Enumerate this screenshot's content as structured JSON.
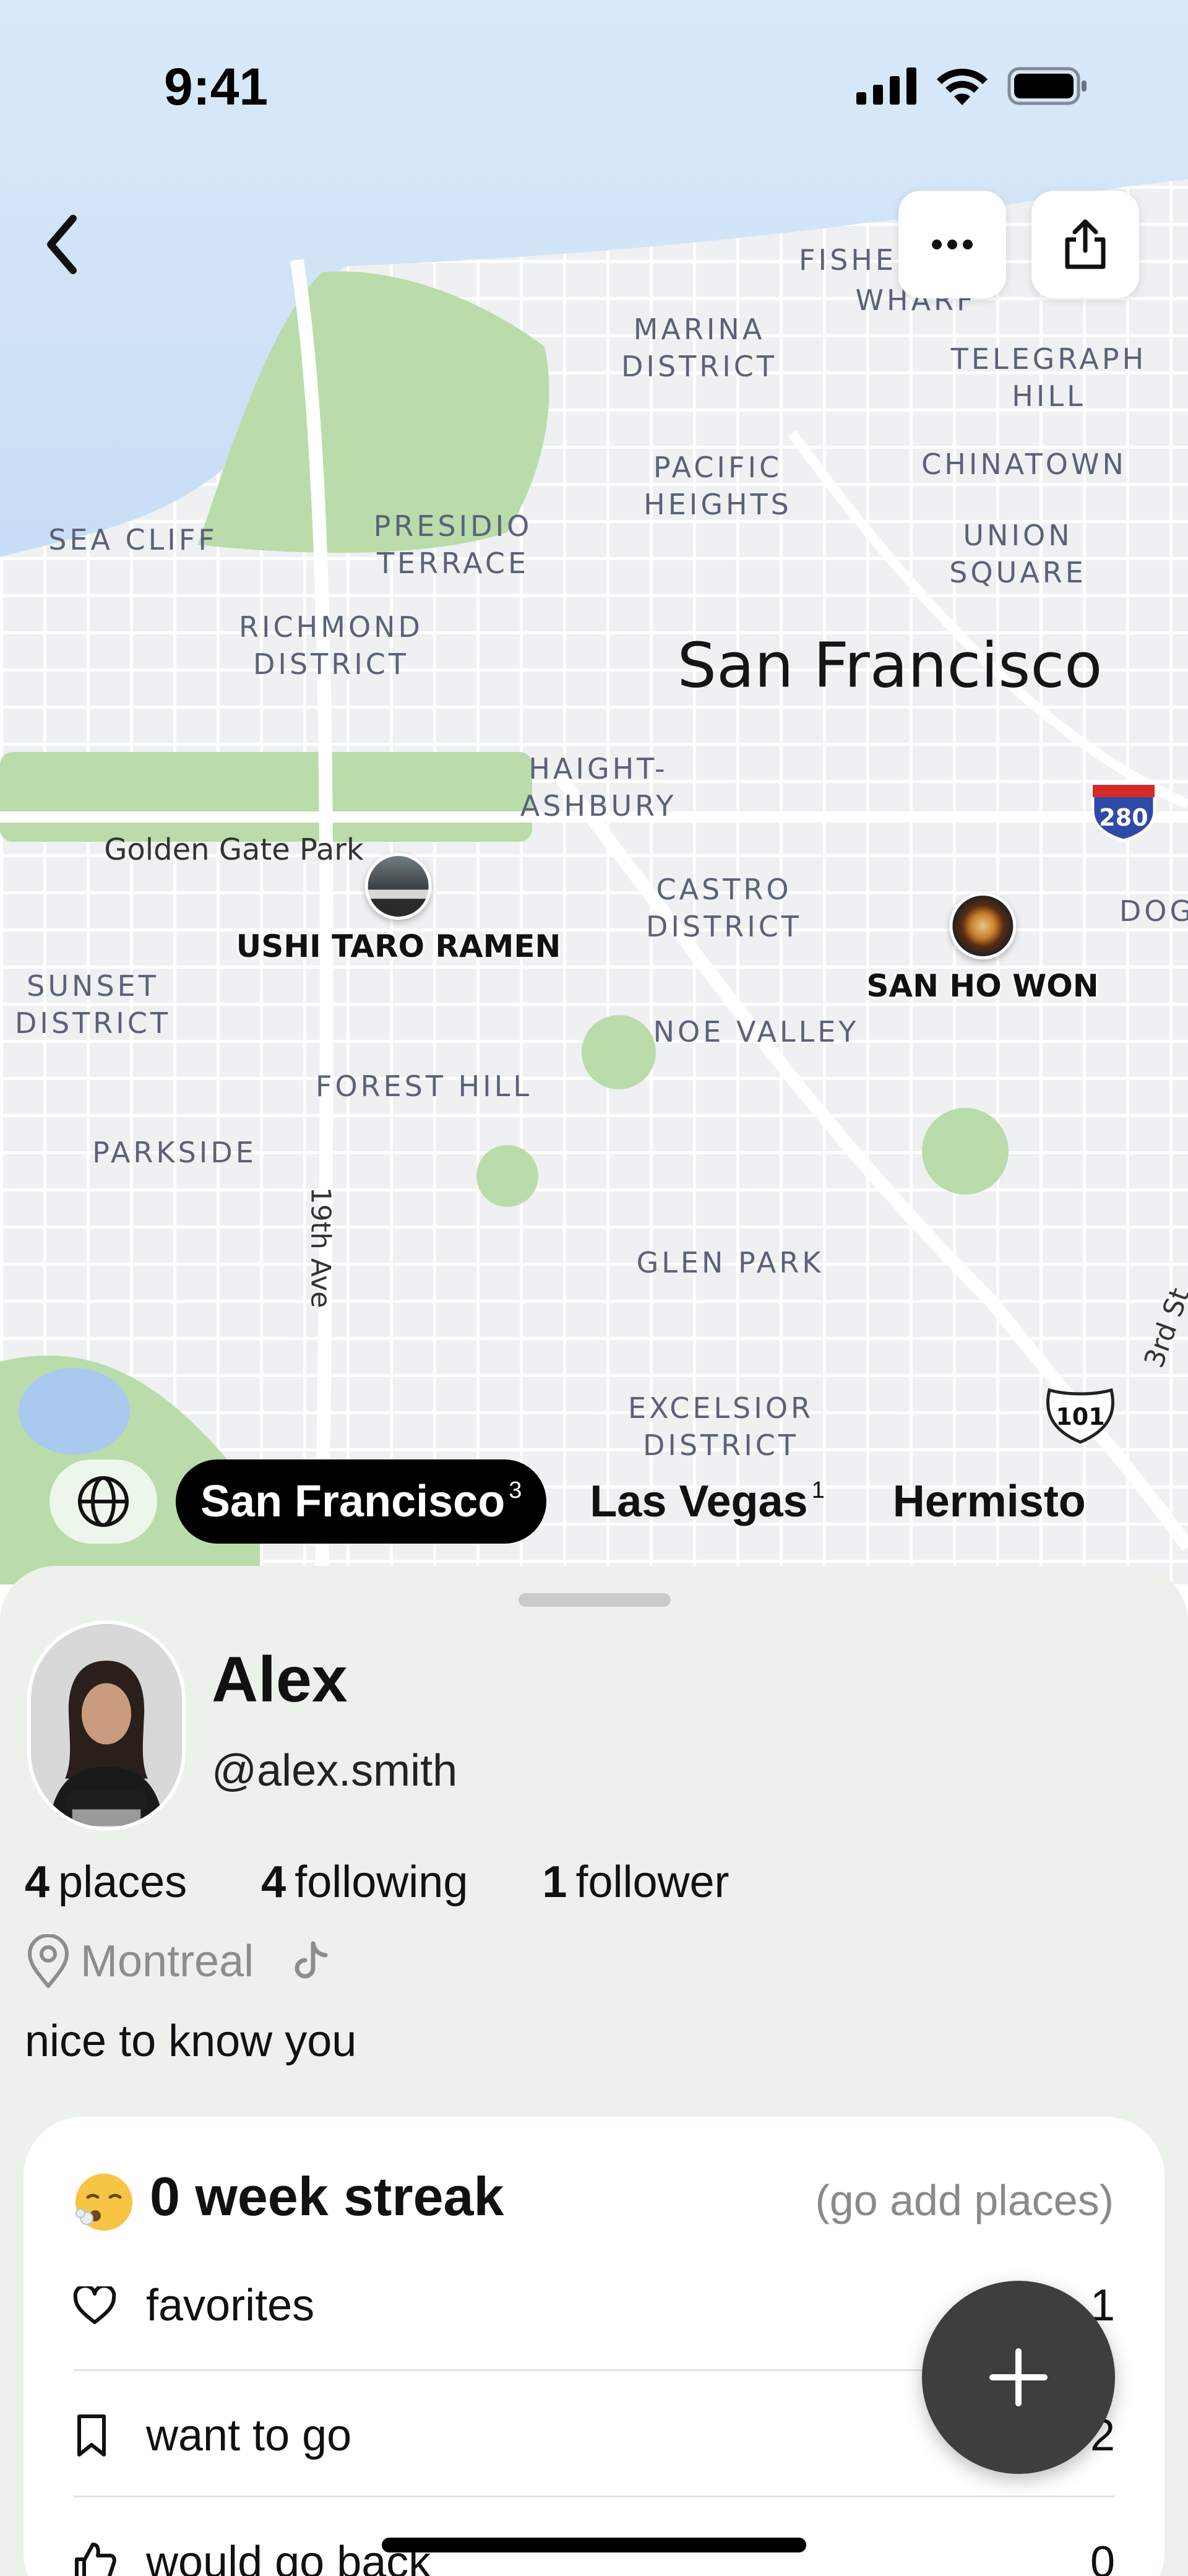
{
  "status_bar": {
    "time": "9:41"
  },
  "map": {
    "city_label": "San Francisco",
    "districts": [
      "MARINA\nDISTRICT",
      "PACIFIC\nHEIGHTS",
      "TELEGRAPH\nHILL",
      "CHINATOWN",
      "UNION\nSQUARE",
      "SEA CLIFF",
      "PRESIDIO\nTERRACE",
      "RICHMOND\nDISTRICT",
      "HAIGHT-\nASHBURY",
      "CASTRO\nDISTRICT",
      "SUNSET\nDISTRICT",
      "NOE VALLEY",
      "FOREST HILL",
      "PARKSIDE",
      "GLEN PARK",
      "EXCELSIOR\nDISTRICT",
      "FISHE",
      "WHARF",
      "DOG"
    ],
    "park_label": "Golden Gate Park",
    "road_labels": [
      "19th Ave",
      "3rd St"
    ],
    "shields": [
      "280",
      "101"
    ],
    "pins": [
      {
        "name": "USHI TARO RAMEN",
        "icon": "ramen-shop-photo"
      },
      {
        "name": "SAN HO WON",
        "icon": "dish-photo"
      }
    ]
  },
  "toolbar": {
    "back_icon": "chevron-left-icon",
    "more_icon": "ellipsis-icon",
    "share_icon": "share-icon"
  },
  "cities": [
    {
      "label": "San Francisco",
      "count": "3",
      "active": true
    },
    {
      "label": "Las Vegas",
      "count": "1",
      "active": false
    },
    {
      "label": "Hermisto",
      "count": "",
      "active": false
    }
  ],
  "profile": {
    "name": "Alex",
    "handle": "@alex.smith",
    "stats": [
      {
        "value": "4",
        "label": "places"
      },
      {
        "value": "4",
        "label": "following"
      },
      {
        "value": "1",
        "label": "follower"
      }
    ],
    "location": "Montreal",
    "bio": "nice to know you"
  },
  "streak": {
    "emoji": "😮‍💨",
    "title": "0 week streak",
    "hint": "(go add places)"
  },
  "lists": [
    {
      "label": "favorites",
      "count": "1",
      "icon": "heart-icon"
    },
    {
      "label": "want to go",
      "count": "2",
      "icon": "bookmark-icon"
    },
    {
      "label": "would go back",
      "count": "0",
      "icon": "thumbs-up-icon"
    }
  ],
  "colors": {
    "park": "#b9dcaa",
    "water": "#a9c9ef",
    "sheet": "#ecf1ec",
    "accent": "#000000"
  }
}
